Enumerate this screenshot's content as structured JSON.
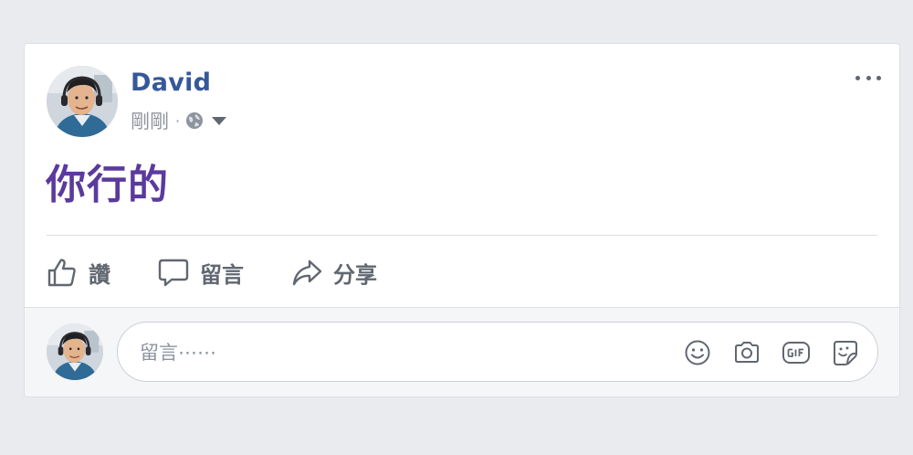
{
  "post": {
    "author": "David",
    "timestamp": "剛剛",
    "separator": "·",
    "audience_icon": "globe-icon",
    "text": "你行的",
    "text_color": "#5b3a9e"
  },
  "actions": {
    "like_label": "讚",
    "comment_label": "留言",
    "share_label": "分享"
  },
  "comment": {
    "placeholder": "留言⋯⋯",
    "tools": [
      "emoji-icon",
      "camera-icon",
      "gif-icon",
      "sticker-icon"
    ]
  },
  "colors": {
    "author_link": "#365899",
    "background": "#e9ebee",
    "action_gray": "#606770"
  }
}
